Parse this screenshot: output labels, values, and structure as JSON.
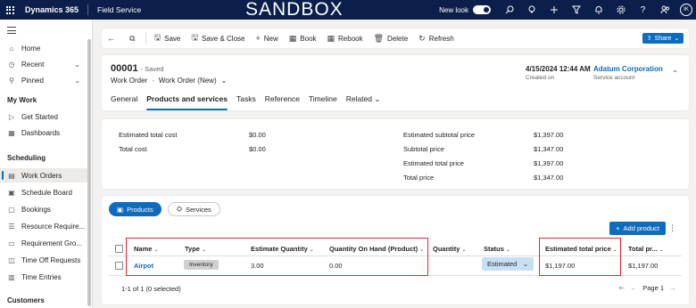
{
  "topbar": {
    "app_name": "Dynamics 365",
    "area_name": "Field Service",
    "environment": "SANDBOX",
    "new_look_label": "New look",
    "avatar_initials": "IK"
  },
  "sidebar": {
    "top_items": [
      {
        "label": "Home",
        "icon": "home-icon"
      },
      {
        "label": "Recent",
        "icon": "clock-icon"
      },
      {
        "label": "Pinned",
        "icon": "pin-icon"
      }
    ],
    "sections": [
      {
        "title": "My Work",
        "items": [
          {
            "label": "Get Started",
            "icon": "play-icon"
          },
          {
            "label": "Dashboards",
            "icon": "dashboard-icon"
          }
        ]
      },
      {
        "title": "Scheduling",
        "items": [
          {
            "label": "Work Orders",
            "icon": "clipboard-icon"
          },
          {
            "label": "Schedule Board",
            "icon": "calendar-icon"
          },
          {
            "label": "Bookings",
            "icon": "booking-icon"
          },
          {
            "label": "Resource Require...",
            "icon": "list-icon"
          },
          {
            "label": "Requirement Gro...",
            "icon": "group-icon"
          },
          {
            "label": "Time Off Requests",
            "icon": "time-off-icon"
          },
          {
            "label": "Time Entries",
            "icon": "entries-icon"
          }
        ]
      },
      {
        "title": "Customers",
        "items": []
      }
    ]
  },
  "commands": {
    "save": "Save",
    "save_close": "Save & Close",
    "new": "New",
    "book": "Book",
    "rebook": "Rebook",
    "delete": "Delete",
    "refresh": "Refresh",
    "share": "Share"
  },
  "record": {
    "number": "00001",
    "saved_status": "- Saved",
    "entity": "Work Order",
    "form": "Work Order (New)",
    "created_on": "4/15/2024 12:44 AM",
    "created_on_label": "Created on",
    "account": "Adatum Corporation",
    "account_label": "Service account",
    "tabs": [
      "General",
      "Products and services",
      "Tasks",
      "Reference",
      "Timeline",
      "Related"
    ]
  },
  "summary": {
    "left": [
      {
        "label": "Estimated total cost",
        "value": "$0.00"
      },
      {
        "label": "Total cost",
        "value": "$0.00"
      }
    ],
    "right": [
      {
        "label": "Estimated subtotal price",
        "value": "$1,397.00"
      },
      {
        "label": "Subtotal price",
        "value": "$1,347.00"
      },
      {
        "label": "Estimated total price",
        "value": "$1,397.00"
      },
      {
        "label": "Total price",
        "value": "$1,347.00"
      }
    ]
  },
  "grid": {
    "tab_products": "Products",
    "tab_services": "Services",
    "add_product": "Add product",
    "columns": [
      "Name",
      "Type",
      "Estimate Quantity",
      "Quantity On Hand (Product)",
      "Quantity",
      "Status",
      "Estimated total price",
      "Total pr..."
    ],
    "rows": [
      {
        "name": "Airpot",
        "type": "Inventory",
        "estimate_quantity": "3.00",
        "quantity_on_hand": "0.00",
        "quantity": "",
        "status": "Estimated",
        "estimated_total_price": "$1,197.00",
        "total_price": "$1,197.00"
      }
    ],
    "footer": "1-1 of 1 (0 selected)",
    "page_label": "Page 1"
  },
  "colors": {
    "topbar": "#0b1f4a",
    "accent": "#0f6cbd",
    "highlight_box": "#e3262d"
  }
}
